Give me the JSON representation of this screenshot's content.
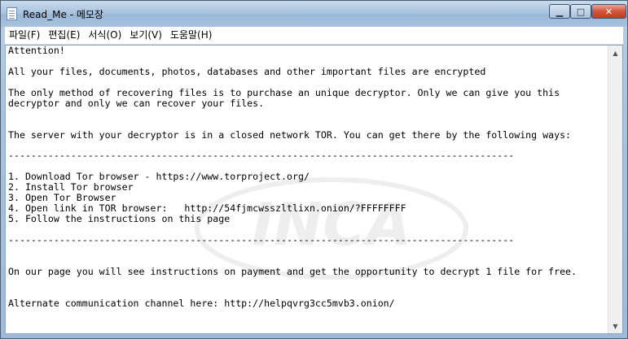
{
  "window": {
    "title": "Read_Me - 메모장",
    "controls": {
      "minimize": "▁",
      "maximize": "□",
      "close": "✕"
    }
  },
  "menu": [
    {
      "label": "파일(F)"
    },
    {
      "label": "편집(E)"
    },
    {
      "label": "서식(O)"
    },
    {
      "label": "보기(V)"
    },
    {
      "label": "도움말(H)"
    }
  ],
  "document": {
    "lines": [
      "Attention!",
      "",
      "All your files, documents, photos, databases and other important files are encrypted",
      "",
      "The only method of recovering files is to purchase an unique decryptor. Only we can give you this",
      "decryptor and only we can recover your files.",
      "",
      "",
      "The server with your decryptor is in a closed network TOR. You can get there by the following ways:",
      "",
      "-----------------------------------------------------------------------------------------",
      "",
      "1. Download Tor browser - https://www.torproject.org/",
      "2. Install Tor browser",
      "3. Open Tor Browser",
      "4. Open link in TOR browser:   http://54fjmcwsszltlixn.onion/?FFFFFFFF",
      "5. Follow the instructions on this page",
      "",
      "-----------------------------------------------------------------------------------------",
      "",
      "",
      "On our page you will see instructions on payment and get the opportunity to decrypt 1 file for free.",
      "",
      "",
      "Alternate communication channel here: http://helpqvrg3cc5mvb3.onion/"
    ]
  },
  "watermark": {
    "brand": "INCA"
  },
  "scrollbar": {
    "up_icon": "triangle-up",
    "down_icon": "triangle-down"
  }
}
